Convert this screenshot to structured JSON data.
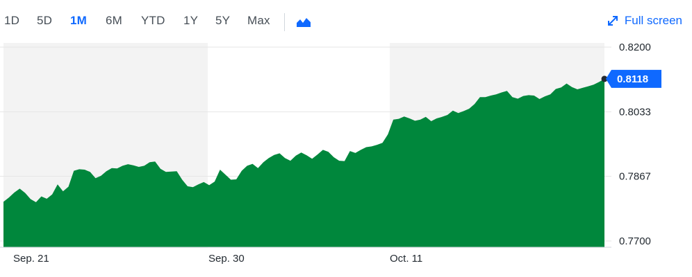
{
  "toolbar": {
    "ranges": [
      "1D",
      "5D",
      "1M",
      "6M",
      "YTD",
      "1Y",
      "5Y",
      "Max"
    ],
    "active_range": "1M",
    "chart_type_icon": "mountain-chart-icon",
    "fullscreen_label": "Full screen",
    "fullscreen_icon": "expand-arrows-icon"
  },
  "colors": {
    "accent": "#0f69ff",
    "area_fill": "#00873c",
    "band_shade": "#f3f3f3",
    "gridline": "#e6e6e6",
    "price_tag": "#0f69ff"
  },
  "chart_data": {
    "type": "area",
    "ylim": [
      0.77,
      0.82
    ],
    "yticks": [
      "0.8200",
      "0.8033",
      "0.7867",
      "0.7700"
    ],
    "xticks": [
      "Sep. 21",
      "Sep. 30",
      "Oct. 11"
    ],
    "current_value": "0.8118",
    "grid": true,
    "series": [
      {
        "values": [
          0.7801,
          0.7812,
          0.7825,
          0.7835,
          0.7824,
          0.7808,
          0.78,
          0.7815,
          0.7809,
          0.782,
          0.7846,
          0.7828,
          0.784,
          0.7881,
          0.7885,
          0.7884,
          0.7878,
          0.7862,
          0.7868,
          0.788,
          0.7888,
          0.7887,
          0.7894,
          0.7898,
          0.7895,
          0.7891,
          0.7894,
          0.7903,
          0.7905,
          0.7886,
          0.7878,
          0.7879,
          0.788,
          0.7858,
          0.7841,
          0.7839,
          0.7846,
          0.7852,
          0.7844,
          0.7853,
          0.7884,
          0.7871,
          0.7858,
          0.7859,
          0.7881,
          0.7894,
          0.7899,
          0.7888,
          0.7903,
          0.7914,
          0.7922,
          0.7926,
          0.7914,
          0.7907,
          0.792,
          0.7928,
          0.7921,
          0.7912,
          0.7923,
          0.7935,
          0.793,
          0.7916,
          0.7907,
          0.7906,
          0.7932,
          0.7927,
          0.7935,
          0.7942,
          0.7944,
          0.7948,
          0.7953,
          0.7975,
          0.8013,
          0.8015,
          0.8021,
          0.8016,
          0.801,
          0.8013,
          0.802,
          0.8009,
          0.8016,
          0.802,
          0.8025,
          0.8036,
          0.803,
          0.8035,
          0.8041,
          0.8053,
          0.8071,
          0.8071,
          0.8075,
          0.8078,
          0.8083,
          0.8087,
          0.8071,
          0.8067,
          0.8074,
          0.8076,
          0.8075,
          0.8066,
          0.8073,
          0.8078,
          0.8092,
          0.8096,
          0.8106,
          0.8097,
          0.8091,
          0.8095,
          0.8099,
          0.8103,
          0.811,
          0.8118
        ]
      }
    ]
  }
}
